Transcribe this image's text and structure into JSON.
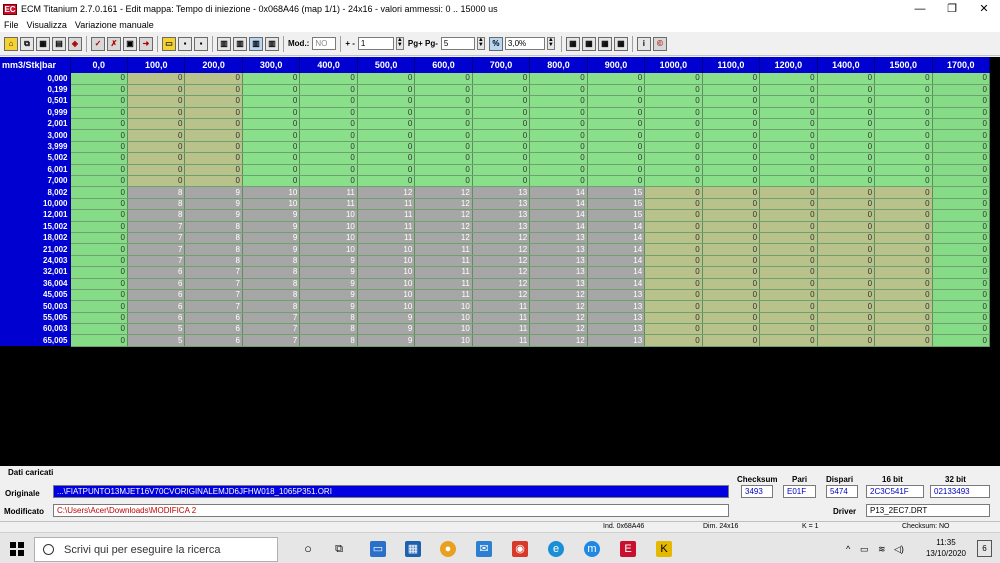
{
  "window": {
    "title": "ECM Titanium 2.7.0.161 - Edit mappa: Tempo di iniezione - 0x068A46 (map 1/1) - 24x16 - valori ammessi: 0 .. 15000 us",
    "minimize": "—",
    "maximize": "❐",
    "close": "✕",
    "app_icon": "EC"
  },
  "menu": [
    "File",
    "Visualizza",
    "Variazione manuale"
  ],
  "toolbar": {
    "mod_label": "Mod.:",
    "mod_value": "NO",
    "step_label": "+ -",
    "step_value": "1",
    "page_label": "Pg+ Pg-",
    "page_value": "5",
    "pct_value": "3,0%",
    "icons": [
      "home-icon",
      "copy-icon",
      "table-icon",
      "chart-icon",
      "3d-icon",
      "check-icon",
      "x-icon",
      "hex-icon",
      "arrow-icon",
      "open-icon",
      "save-icon",
      "save-as-icon",
      "view-1-icon",
      "view-2-icon",
      "view-3-icon",
      "view-4-icon",
      "grid-icon",
      "grid2-icon",
      "grid3-icon",
      "grid4-icon",
      "info-icon",
      "help-icon"
    ]
  },
  "map": {
    "corner": "mm3/Stk|bar",
    "columns": [
      "0,0",
      "100,0",
      "200,0",
      "300,0",
      "400,0",
      "500,0",
      "600,0",
      "700,0",
      "800,0",
      "900,0",
      "1000,0",
      "1100,0",
      "1200,0",
      "1400,0",
      "1500,0",
      "1700,0"
    ],
    "rows": [
      {
        "h": "0,000",
        "v": [
          0,
          0,
          0,
          0,
          0,
          0,
          0,
          0,
          0,
          0,
          0,
          0,
          0,
          0,
          0,
          0
        ]
      },
      {
        "h": "0,199",
        "v": [
          0,
          0,
          0,
          0,
          0,
          0,
          0,
          0,
          0,
          0,
          0,
          0,
          0,
          0,
          0,
          0
        ]
      },
      {
        "h": "0,501",
        "v": [
          0,
          0,
          0,
          0,
          0,
          0,
          0,
          0,
          0,
          0,
          0,
          0,
          0,
          0,
          0,
          0
        ]
      },
      {
        "h": "0,999",
        "v": [
          0,
          0,
          0,
          0,
          0,
          0,
          0,
          0,
          0,
          0,
          0,
          0,
          0,
          0,
          0,
          0
        ]
      },
      {
        "h": "2,001",
        "v": [
          0,
          0,
          0,
          0,
          0,
          0,
          0,
          0,
          0,
          0,
          0,
          0,
          0,
          0,
          0,
          0
        ]
      },
      {
        "h": "3,000",
        "v": [
          0,
          0,
          0,
          0,
          0,
          0,
          0,
          0,
          0,
          0,
          0,
          0,
          0,
          0,
          0,
          0
        ]
      },
      {
        "h": "3,999",
        "v": [
          0,
          0,
          0,
          0,
          0,
          0,
          0,
          0,
          0,
          0,
          0,
          0,
          0,
          0,
          0,
          0
        ]
      },
      {
        "h": "5,002",
        "v": [
          0,
          0,
          0,
          0,
          0,
          0,
          0,
          0,
          0,
          0,
          0,
          0,
          0,
          0,
          0,
          0
        ]
      },
      {
        "h": "6,001",
        "v": [
          0,
          0,
          0,
          0,
          0,
          0,
          0,
          0,
          0,
          0,
          0,
          0,
          0,
          0,
          0,
          0
        ]
      },
      {
        "h": "7,000",
        "v": [
          0,
          0,
          0,
          0,
          0,
          0,
          0,
          0,
          0,
          0,
          0,
          0,
          0,
          0,
          0,
          0
        ]
      },
      {
        "h": "8,002",
        "v": [
          0,
          8,
          9,
          10,
          11,
          12,
          12,
          13,
          14,
          15,
          0,
          0,
          0,
          0,
          0,
          0
        ]
      },
      {
        "h": "10,000",
        "v": [
          0,
          8,
          9,
          10,
          11,
          11,
          12,
          13,
          14,
          15,
          0,
          0,
          0,
          0,
          0,
          0
        ]
      },
      {
        "h": "12,001",
        "v": [
          0,
          8,
          9,
          9,
          10,
          11,
          12,
          13,
          14,
          15,
          0,
          0,
          0,
          0,
          0,
          0
        ]
      },
      {
        "h": "15,002",
        "v": [
          0,
          7,
          8,
          9,
          10,
          11,
          12,
          13,
          14,
          14,
          0,
          0,
          0,
          0,
          0,
          0
        ]
      },
      {
        "h": "18,002",
        "v": [
          0,
          7,
          8,
          9,
          10,
          11,
          12,
          12,
          13,
          14,
          0,
          0,
          0,
          0,
          0,
          0
        ]
      },
      {
        "h": "21,002",
        "v": [
          0,
          7,
          8,
          9,
          10,
          10,
          11,
          12,
          13,
          14,
          0,
          0,
          0,
          0,
          0,
          0
        ]
      },
      {
        "h": "24,003",
        "v": [
          0,
          7,
          8,
          8,
          9,
          10,
          11,
          12,
          13,
          14,
          0,
          0,
          0,
          0,
          0,
          0
        ]
      },
      {
        "h": "32,001",
        "v": [
          0,
          6,
          7,
          8,
          9,
          10,
          11,
          12,
          13,
          14,
          0,
          0,
          0,
          0,
          0,
          0
        ]
      },
      {
        "h": "36,004",
        "v": [
          0,
          6,
          7,
          8,
          9,
          10,
          11,
          12,
          13,
          14,
          0,
          0,
          0,
          0,
          0,
          0
        ]
      },
      {
        "h": "45,005",
        "v": [
          0,
          6,
          7,
          8,
          9,
          10,
          11,
          12,
          12,
          13,
          0,
          0,
          0,
          0,
          0,
          0
        ]
      },
      {
        "h": "50,003",
        "v": [
          0,
          6,
          7,
          8,
          9,
          10,
          10,
          11,
          12,
          13,
          0,
          0,
          0,
          0,
          0,
          0
        ]
      },
      {
        "h": "55,005",
        "v": [
          0,
          6,
          6,
          7,
          8,
          9,
          10,
          11,
          12,
          13,
          0,
          0,
          0,
          0,
          0,
          0
        ]
      },
      {
        "h": "60,003",
        "v": [
          0,
          5,
          6,
          7,
          8,
          9,
          10,
          11,
          12,
          13,
          0,
          0,
          0,
          0,
          0,
          0
        ]
      },
      {
        "h": "65,005",
        "v": [
          0,
          5,
          6,
          7,
          8,
          9,
          10,
          11,
          12,
          13,
          0,
          0,
          0,
          0,
          0,
          0
        ]
      }
    ]
  },
  "footer": {
    "loaded_label": "Dati caricati",
    "orig_label": "Originale",
    "orig_file": "...\\FIATPUNTO13MJET16V70CVORIGINALEMJD6JFHW018_1065P351.ORI",
    "mod_label": "Modificato",
    "mod_file": "C:\\Users\\Acer\\Downloads\\MODIFICA 2",
    "checksum_label": "Checksum",
    "checksum": "3493",
    "pari_label": "Pari",
    "pari": "E01F",
    "dispari_label": "Dispari",
    "dispari": "5474",
    "bit16_label": "16 bit",
    "bit16": "2C3C541F",
    "bit32_label": "32 bit",
    "bit32": "02133493",
    "driver_label": "Driver",
    "driver": "P13_2EC7.DRT"
  },
  "status": {
    "ind": "Ind. 0x68A46",
    "dim": "Dim. 24x16",
    "k": "K = 1",
    "checksum": "Checksum: NO"
  },
  "taskbar": {
    "search_placeholder": "Scrivi qui per eseguire la ricerca",
    "time": "11:35",
    "date": "13/10/2020",
    "notif_count": "6"
  }
}
